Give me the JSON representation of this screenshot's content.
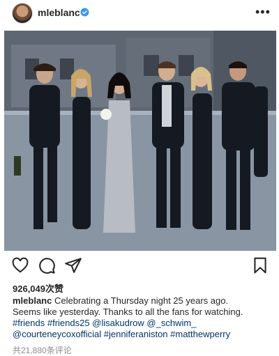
{
  "post": {
    "username": "mleblanc",
    "verified_icon": "verified-badge-icon",
    "more_icon": "more-options-icon"
  },
  "image": {
    "alt_description": "Six people in formal black outfits walking arm in arm down a city street",
    "colors": {
      "sky": "#8c98a6",
      "street": "#7d8692",
      "buildings": "#6a727d",
      "suits": "#151a22",
      "dress": "#b7bcc5"
    }
  },
  "actions": {
    "like_icon": "heart-icon",
    "comment_icon": "comment-icon",
    "share_icon": "share-icon",
    "save_icon": "bookmark-icon"
  },
  "likes": "926,049次赞",
  "caption": {
    "username": "mleblanc",
    "line1": "Celebrating a Thursday night 25 years ago.",
    "line2": "Seems like yesterday. Thanks to all the fans for watching.",
    "line3": "#friends #friends25 @lisakudrow @_schwim_",
    "line4": "@courteneycoxofficial #jenniferaniston #matthewperry"
  },
  "comments": "共21,880条评论"
}
